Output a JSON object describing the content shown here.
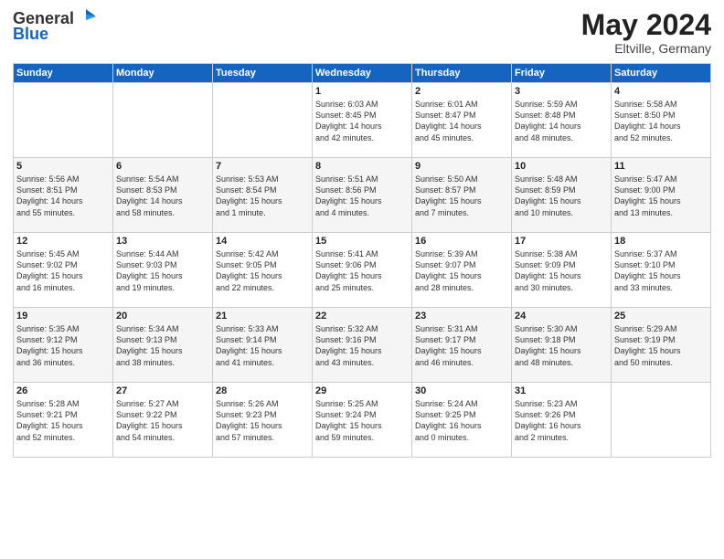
{
  "header": {
    "logo_line1": "General",
    "logo_line2": "Blue",
    "month_year": "May 2024",
    "location": "Eltville, Germany"
  },
  "days_of_week": [
    "Sunday",
    "Monday",
    "Tuesday",
    "Wednesday",
    "Thursday",
    "Friday",
    "Saturday"
  ],
  "weeks": [
    [
      {
        "day": "",
        "info": ""
      },
      {
        "day": "",
        "info": ""
      },
      {
        "day": "",
        "info": ""
      },
      {
        "day": "1",
        "info": "Sunrise: 6:03 AM\nSunset: 8:45 PM\nDaylight: 14 hours\nand 42 minutes."
      },
      {
        "day": "2",
        "info": "Sunrise: 6:01 AM\nSunset: 8:47 PM\nDaylight: 14 hours\nand 45 minutes."
      },
      {
        "day": "3",
        "info": "Sunrise: 5:59 AM\nSunset: 8:48 PM\nDaylight: 14 hours\nand 48 minutes."
      },
      {
        "day": "4",
        "info": "Sunrise: 5:58 AM\nSunset: 8:50 PM\nDaylight: 14 hours\nand 52 minutes."
      }
    ],
    [
      {
        "day": "5",
        "info": "Sunrise: 5:56 AM\nSunset: 8:51 PM\nDaylight: 14 hours\nand 55 minutes."
      },
      {
        "day": "6",
        "info": "Sunrise: 5:54 AM\nSunset: 8:53 PM\nDaylight: 14 hours\nand 58 minutes."
      },
      {
        "day": "7",
        "info": "Sunrise: 5:53 AM\nSunset: 8:54 PM\nDaylight: 15 hours\nand 1 minute."
      },
      {
        "day": "8",
        "info": "Sunrise: 5:51 AM\nSunset: 8:56 PM\nDaylight: 15 hours\nand 4 minutes."
      },
      {
        "day": "9",
        "info": "Sunrise: 5:50 AM\nSunset: 8:57 PM\nDaylight: 15 hours\nand 7 minutes."
      },
      {
        "day": "10",
        "info": "Sunrise: 5:48 AM\nSunset: 8:59 PM\nDaylight: 15 hours\nand 10 minutes."
      },
      {
        "day": "11",
        "info": "Sunrise: 5:47 AM\nSunset: 9:00 PM\nDaylight: 15 hours\nand 13 minutes."
      }
    ],
    [
      {
        "day": "12",
        "info": "Sunrise: 5:45 AM\nSunset: 9:02 PM\nDaylight: 15 hours\nand 16 minutes."
      },
      {
        "day": "13",
        "info": "Sunrise: 5:44 AM\nSunset: 9:03 PM\nDaylight: 15 hours\nand 19 minutes."
      },
      {
        "day": "14",
        "info": "Sunrise: 5:42 AM\nSunset: 9:05 PM\nDaylight: 15 hours\nand 22 minutes."
      },
      {
        "day": "15",
        "info": "Sunrise: 5:41 AM\nSunset: 9:06 PM\nDaylight: 15 hours\nand 25 minutes."
      },
      {
        "day": "16",
        "info": "Sunrise: 5:39 AM\nSunset: 9:07 PM\nDaylight: 15 hours\nand 28 minutes."
      },
      {
        "day": "17",
        "info": "Sunrise: 5:38 AM\nSunset: 9:09 PM\nDaylight: 15 hours\nand 30 minutes."
      },
      {
        "day": "18",
        "info": "Sunrise: 5:37 AM\nSunset: 9:10 PM\nDaylight: 15 hours\nand 33 minutes."
      }
    ],
    [
      {
        "day": "19",
        "info": "Sunrise: 5:35 AM\nSunset: 9:12 PM\nDaylight: 15 hours\nand 36 minutes."
      },
      {
        "day": "20",
        "info": "Sunrise: 5:34 AM\nSunset: 9:13 PM\nDaylight: 15 hours\nand 38 minutes."
      },
      {
        "day": "21",
        "info": "Sunrise: 5:33 AM\nSunset: 9:14 PM\nDaylight: 15 hours\nand 41 minutes."
      },
      {
        "day": "22",
        "info": "Sunrise: 5:32 AM\nSunset: 9:16 PM\nDaylight: 15 hours\nand 43 minutes."
      },
      {
        "day": "23",
        "info": "Sunrise: 5:31 AM\nSunset: 9:17 PM\nDaylight: 15 hours\nand 46 minutes."
      },
      {
        "day": "24",
        "info": "Sunrise: 5:30 AM\nSunset: 9:18 PM\nDaylight: 15 hours\nand 48 minutes."
      },
      {
        "day": "25",
        "info": "Sunrise: 5:29 AM\nSunset: 9:19 PM\nDaylight: 15 hours\nand 50 minutes."
      }
    ],
    [
      {
        "day": "26",
        "info": "Sunrise: 5:28 AM\nSunset: 9:21 PM\nDaylight: 15 hours\nand 52 minutes."
      },
      {
        "day": "27",
        "info": "Sunrise: 5:27 AM\nSunset: 9:22 PM\nDaylight: 15 hours\nand 54 minutes."
      },
      {
        "day": "28",
        "info": "Sunrise: 5:26 AM\nSunset: 9:23 PM\nDaylight: 15 hours\nand 57 minutes."
      },
      {
        "day": "29",
        "info": "Sunrise: 5:25 AM\nSunset: 9:24 PM\nDaylight: 15 hours\nand 59 minutes."
      },
      {
        "day": "30",
        "info": "Sunrise: 5:24 AM\nSunset: 9:25 PM\nDaylight: 16 hours\nand 0 minutes."
      },
      {
        "day": "31",
        "info": "Sunrise: 5:23 AM\nSunset: 9:26 PM\nDaylight: 16 hours\nand 2 minutes."
      },
      {
        "day": "",
        "info": ""
      }
    ]
  ]
}
